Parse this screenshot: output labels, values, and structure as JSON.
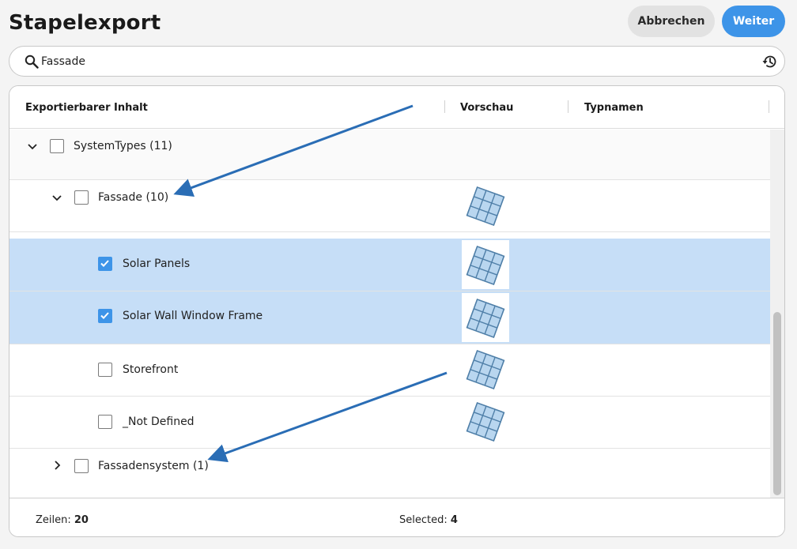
{
  "page": {
    "title": "Stapelexport"
  },
  "actions": {
    "cancel_label": "Abbrechen",
    "next_label": "Weiter"
  },
  "search": {
    "value": "Fassade",
    "icon": "search-icon",
    "history_icon": "history-icon"
  },
  "table": {
    "columns": [
      "Exportierbarer Inhalt",
      "Vorschau",
      "Typnamen"
    ],
    "rows": [
      {
        "label": "SystemTypes (11)",
        "expanded": true,
        "checked": false,
        "preview": false
      },
      {
        "label": "Fassade (10)",
        "expanded": true,
        "checked": false,
        "preview": true
      },
      {
        "label": "Solar Panels",
        "checked": true,
        "preview": true,
        "selected": true
      },
      {
        "label": "Solar Wall Window Frame",
        "checked": true,
        "preview": true,
        "selected": true
      },
      {
        "label": "Storefront",
        "checked": false,
        "preview": true
      },
      {
        "label": "_Not Defined",
        "checked": false,
        "preview": true
      },
      {
        "label": "Fassadensystem (1)",
        "expanded": false,
        "checked": false,
        "preview": false
      }
    ]
  },
  "footer": {
    "rows_label": "Zeilen:",
    "rows_value": "20",
    "selected_label": "Selected:",
    "selected_value": "4"
  },
  "colors": {
    "accent": "#3d94e8",
    "selection": "#c6def7",
    "annotation_arrow": "#2a6db5"
  }
}
